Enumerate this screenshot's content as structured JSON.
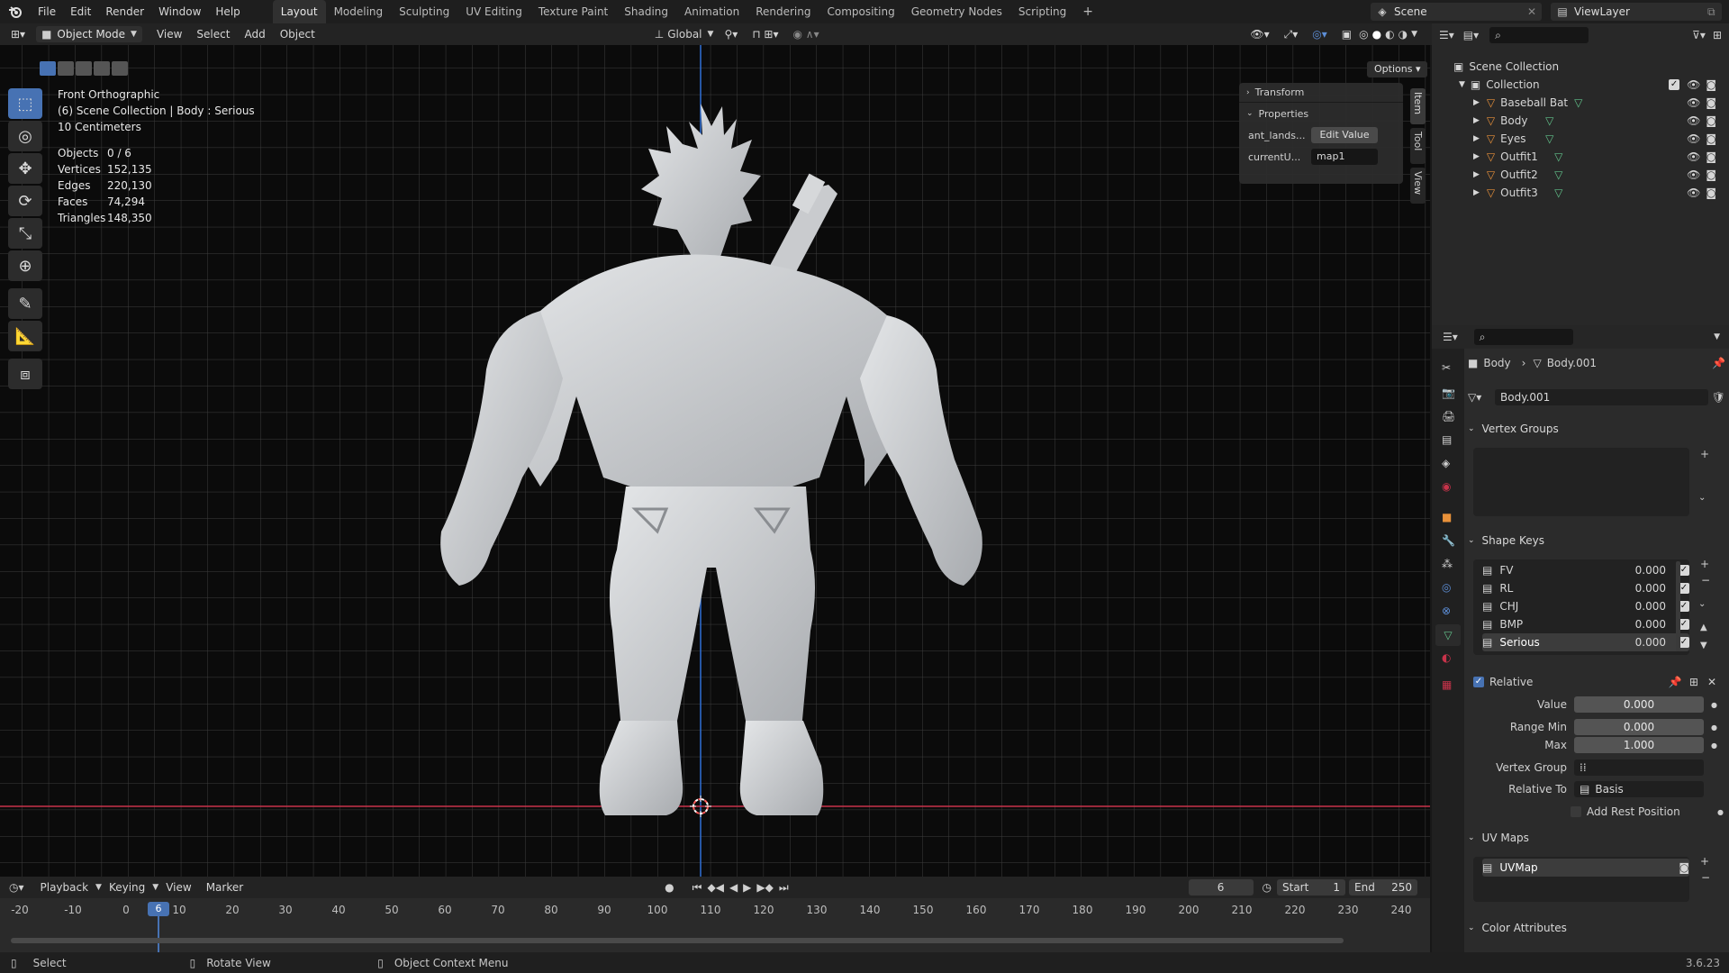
{
  "app": {
    "version": "3.6.23"
  },
  "menu": [
    "File",
    "Edit",
    "Render",
    "Window",
    "Help"
  ],
  "workspaces": [
    "Layout",
    "Modeling",
    "Sculpting",
    "UV Editing",
    "Texture Paint",
    "Shading",
    "Animation",
    "Rendering",
    "Compositing",
    "Geometry Nodes",
    "Scripting"
  ],
  "active_workspace": "Layout",
  "scene": {
    "name": "Scene",
    "view_layer": "ViewLayer"
  },
  "viewport_header": {
    "mode": "Object Mode",
    "menus": [
      "View",
      "Select",
      "Add",
      "Object"
    ],
    "orientation": "Global",
    "options": "Options"
  },
  "viewport": {
    "view_name": "Front Orthographic",
    "context": "(6) Scene Collection | Body : Serious",
    "scale": "10 Centimeters",
    "stats": [
      {
        "label": "Objects",
        "value": "0 / 6"
      },
      {
        "label": "Vertices",
        "value": "152,135"
      },
      {
        "label": "Edges",
        "value": "220,130"
      },
      {
        "label": "Faces",
        "value": "74,294"
      },
      {
        "label": "Triangles",
        "value": "148,350"
      }
    ],
    "side_tabs": [
      "Item",
      "Tool",
      "View"
    ]
  },
  "n_panel": {
    "transform": "Transform",
    "properties": "Properties",
    "row1": {
      "label": "ant_lands...",
      "button": "Edit Value"
    },
    "row2": {
      "label": "currentU...",
      "value": "map1"
    }
  },
  "outliner": {
    "root": "Scene Collection",
    "collection": "Collection",
    "objects": [
      "Baseball Bat",
      "Body",
      "Eyes",
      "Outfit1",
      "Outfit2",
      "Outfit3"
    ]
  },
  "properties": {
    "breadcrumb": {
      "object": "Body",
      "data": "Body.001"
    },
    "mesh_name": "Body.001",
    "vertex_groups": "Vertex Groups",
    "shape_keys": {
      "title": "Shape Keys",
      "items": [
        {
          "name": "FV",
          "value": "0.000"
        },
        {
          "name": "RL",
          "value": "0.000"
        },
        {
          "name": "CHJ",
          "value": "0.000"
        },
        {
          "name": "BMP",
          "value": "0.000"
        },
        {
          "name": "Serious",
          "value": "0.000"
        }
      ]
    },
    "relative": "Relative",
    "value_label": "Value",
    "value": "0.000",
    "range_min_label": "Range Min",
    "range_min": "0.000",
    "max_label": "Max",
    "max": "1.000",
    "vertex_group_label": "Vertex Group",
    "relative_to_label": "Relative To",
    "relative_to": "Basis",
    "add_rest_position": "Add Rest Position",
    "uv_maps": {
      "title": "UV Maps",
      "item": "UVMap"
    },
    "color_attributes": "Color Attributes"
  },
  "timeline": {
    "menus": [
      "Playback",
      "Keying",
      "View",
      "Marker"
    ],
    "current_frame": "6",
    "start_label": "Start",
    "start": "1",
    "end_label": "End",
    "end": "250",
    "ruler": [
      "-20",
      "-10",
      "0",
      "10",
      "20",
      "30",
      "40",
      "50",
      "60",
      "70",
      "80",
      "90",
      "100",
      "110",
      "120",
      "130",
      "140",
      "150",
      "160",
      "170",
      "180",
      "190",
      "200",
      "210",
      "220",
      "230",
      "240"
    ],
    "playhead": "6"
  },
  "statusbar": {
    "select": "Select",
    "rotate": "Rotate View",
    "context": "Object Context Menu"
  },
  "colors": {
    "accent": "#4772b3",
    "orange": "#e8913a",
    "green": "#62c38b",
    "x_axis": "#c8334a",
    "z_axis": "#2f6fd6"
  }
}
